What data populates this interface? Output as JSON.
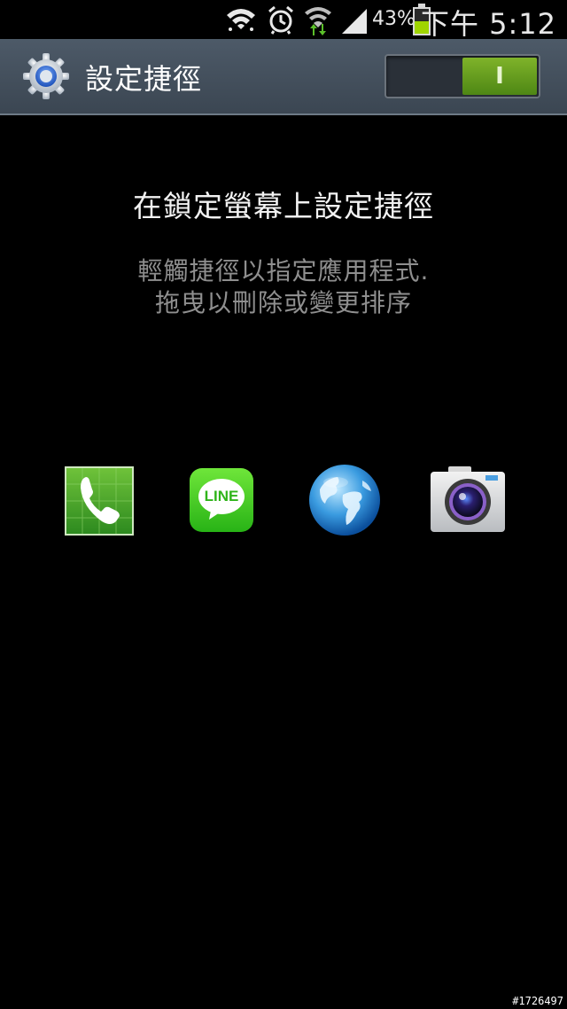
{
  "status_bar": {
    "icons": [
      "wifi-icon",
      "alarm-icon",
      "wifi-data-icon",
      "signal-icon",
      "battery-icon"
    ],
    "battery_percent": "43%",
    "time": "下午 5:12"
  },
  "action_bar": {
    "title": "設定捷徑",
    "icon": "settings-gear-icon",
    "toggle": {
      "state": "on",
      "label": "I",
      "color": "#5a9a1c"
    }
  },
  "main": {
    "heading": "在鎖定螢幕上設定捷徑",
    "description_lines": [
      "輕觸捷徑以指定應用程式.",
      "拖曳以刪除或變更排序"
    ]
  },
  "shortcuts": [
    {
      "name": "phone",
      "icon": "phone-icon"
    },
    {
      "name": "line",
      "icon": "line-icon",
      "text": "LINE"
    },
    {
      "name": "internet",
      "icon": "globe-icon"
    },
    {
      "name": "camera",
      "icon": "camera-icon"
    }
  ],
  "watermark": "#1726497"
}
